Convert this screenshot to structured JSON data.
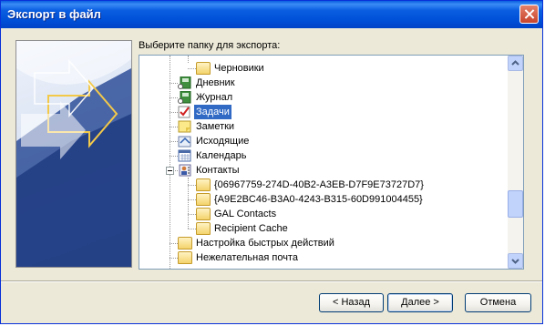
{
  "window": {
    "title": "Экспорт в файл"
  },
  "prompt": "Выберите папку для экспорта:",
  "tree": [
    {
      "label": "Черновики",
      "icon": "folder-icon",
      "depth": 2
    },
    {
      "label": "Дневник",
      "icon": "journal-icon",
      "depth": 1
    },
    {
      "label": "Журнал",
      "icon": "journal-icon",
      "depth": 1
    },
    {
      "label": "Задачи",
      "icon": "tasks-icon",
      "depth": 1,
      "selected": true
    },
    {
      "label": "Заметки",
      "icon": "notes-icon",
      "depth": 1
    },
    {
      "label": "Исходящие",
      "icon": "outbox-icon",
      "depth": 1
    },
    {
      "label": "Календарь",
      "icon": "calendar-icon",
      "depth": 1
    },
    {
      "label": "Контакты",
      "icon": "contacts-icon",
      "depth": 1,
      "expanded": true
    },
    {
      "label": "{06967759-274D-40B2-A3EB-D7F9E73727D7}",
      "icon": "folder-icon",
      "depth": 2
    },
    {
      "label": "{A9E2BC46-B3A0-4243-B315-60D991004455}",
      "icon": "folder-icon",
      "depth": 2
    },
    {
      "label": "GAL Contacts",
      "icon": "folder-icon",
      "depth": 2
    },
    {
      "label": "Recipient Cache",
      "icon": "folder-icon",
      "depth": 2
    },
    {
      "label": "Настройка быстрых действий",
      "icon": "folder-icon",
      "depth": 1
    },
    {
      "label": "Нежелательная почта",
      "icon": "folder-icon",
      "depth": 1
    }
  ],
  "buttons": {
    "back": "< Назад",
    "next": "Далее >",
    "cancel": "Отмена"
  },
  "colors": {
    "selection": "#316ac5",
    "titlebar": "#0a5de0"
  }
}
